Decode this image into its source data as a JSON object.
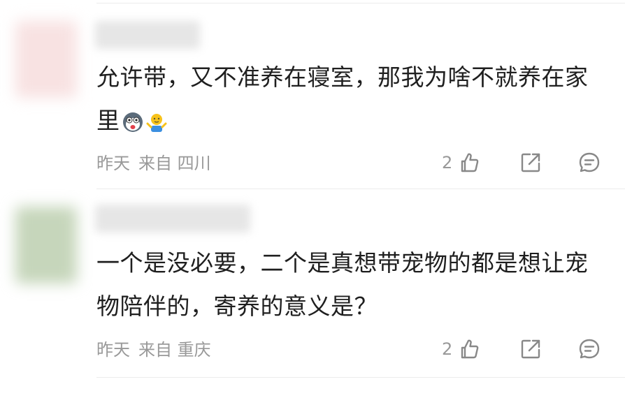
{
  "comments": [
    {
      "avatar_color": "#f6dede",
      "text_line1": "允许带，又不准养在寝室，那我为啥不就养在家",
      "text_line2": "里",
      "emojis": [
        "husky-emoji",
        "shrug-emoji"
      ],
      "time": "昨天",
      "location": "来自 四川",
      "like_count": "2"
    },
    {
      "avatar_color": "#c9d7bf",
      "text_line1": "一个是没必要，二个是真想带宠物的都是想让宠",
      "text_line2": "物陪伴的，寄养的意义是？",
      "emojis": [],
      "time": "昨天",
      "location": "来自 重庆",
      "like_count": "2"
    }
  ],
  "icons": {
    "like": "thumbs-up-icon",
    "share": "share-icon",
    "reply": "comment-icon"
  },
  "colors": {
    "meta": "#999999",
    "text": "#1f1f1f",
    "divider": "#ececec"
  }
}
